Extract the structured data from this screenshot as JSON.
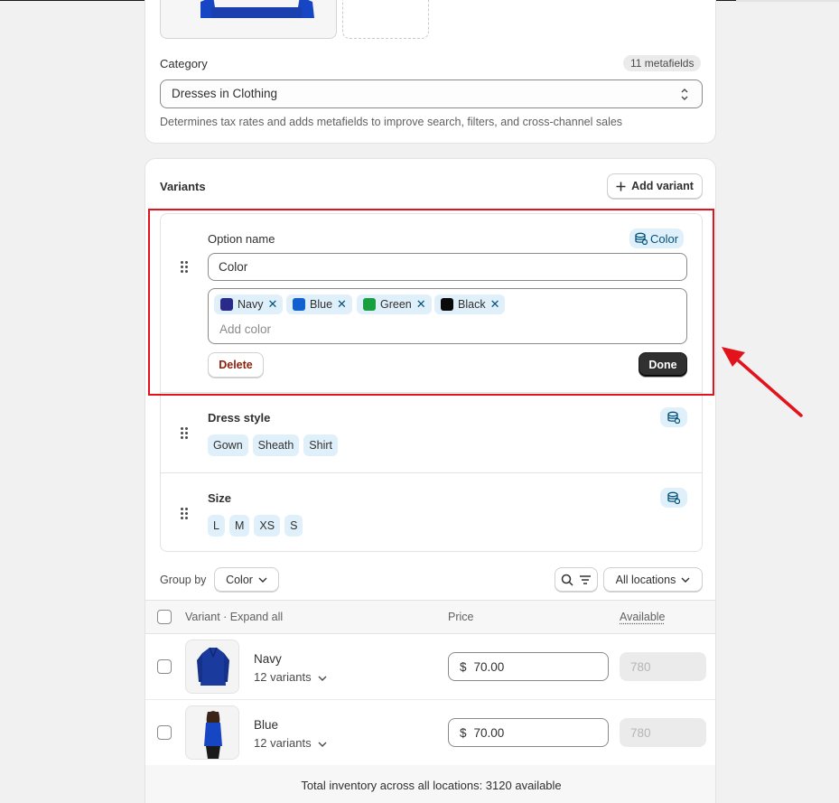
{
  "category": {
    "label": "Category",
    "metafields_badge": "11 metafields",
    "value_main": "Dresses",
    "value_in": " in ",
    "value_parent": "Clothing",
    "help": "Determines tax rates and adds metafields to improve search, filters, and cross-channel sales"
  },
  "variants": {
    "title": "Variants",
    "add_variant": "Add variant",
    "option_editor": {
      "label": "Option name",
      "metafield_badge": "Color",
      "name_value": "Color",
      "values": [
        {
          "label": "Navy",
          "color": "#2a2a8a"
        },
        {
          "label": "Blue",
          "color": "#1060d0"
        },
        {
          "label": "Green",
          "color": "#18a040"
        },
        {
          "label": "Black",
          "color": "#0a0a0a"
        }
      ],
      "add_placeholder": "Add color",
      "delete": "Delete",
      "done": "Done"
    },
    "options": [
      {
        "name": "Dress style",
        "values": [
          "Gown",
          "Sheath",
          "Shirt"
        ]
      },
      {
        "name": "Size",
        "values": [
          "L",
          "M",
          "XS",
          "S"
        ]
      }
    ]
  },
  "toolbar": {
    "group_by_label": "Group by",
    "group_by_value": "Color",
    "locations": "All locations"
  },
  "table": {
    "col_variant": "Variant",
    "col_sep": " · ",
    "col_expand": "Expand all",
    "col_price": "Price",
    "col_available": "Available",
    "rows": [
      {
        "name": "Navy",
        "count": "12 variants",
        "currency": "$",
        "price": "70.00",
        "available": "780"
      },
      {
        "name": "Blue",
        "count": "12 variants",
        "currency": "$",
        "price": "70.00",
        "available": "780"
      }
    ],
    "total": "Total inventory across all locations: 3120 available"
  },
  "colors": {
    "highlight": "#e3131b",
    "badge_bg": "#e0f0fa",
    "primary_button": "#303030"
  }
}
